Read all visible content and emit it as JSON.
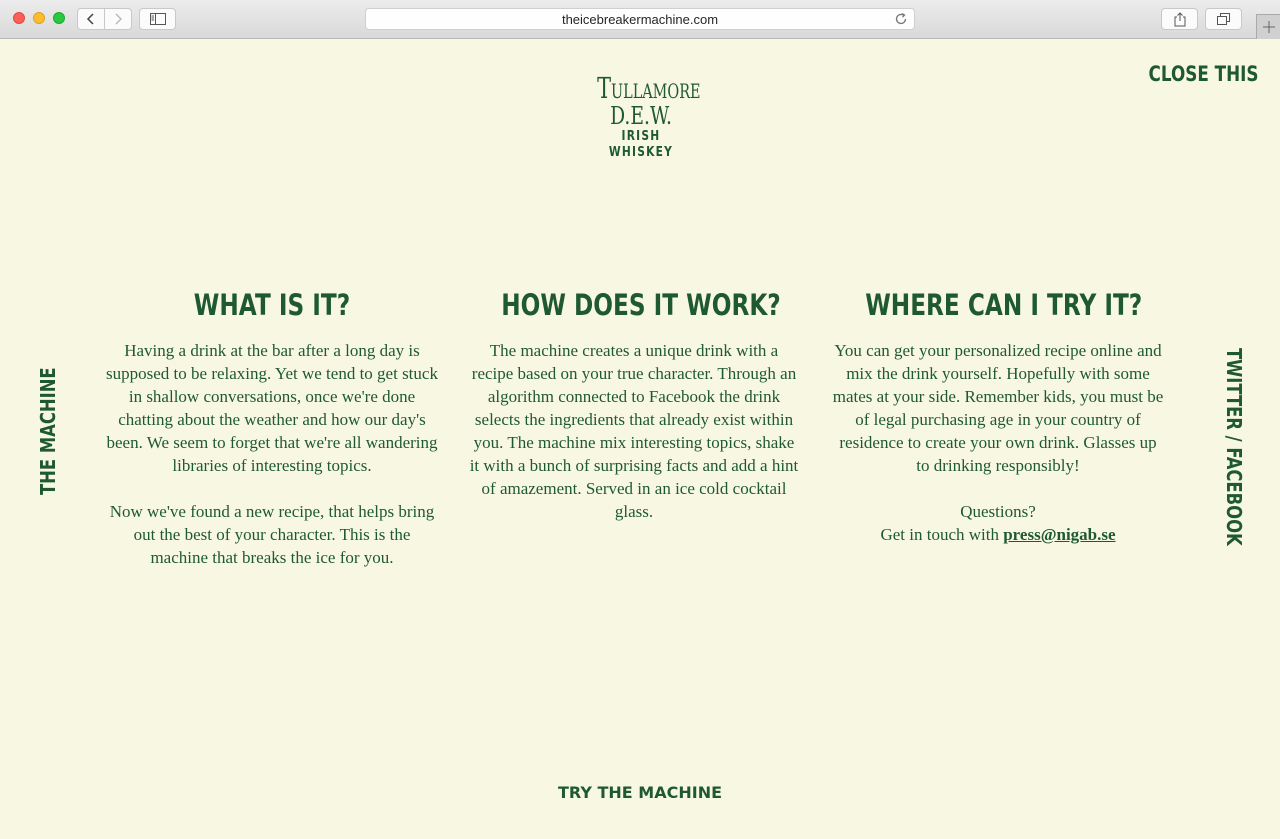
{
  "browser": {
    "url": "theicebreakermachine.com",
    "icons": {
      "back": "chevron-left-icon",
      "forward": "chevron-right-icon",
      "sidebar": "sidebar-icon",
      "reload": "reload-icon",
      "share": "share-icon",
      "tabs": "tabs-icon",
      "new_tab": "plus-icon"
    }
  },
  "logo": {
    "line1": "Tullamore",
    "line2": "D.E.W.",
    "line3": "IRISH WHISKEY"
  },
  "nav": {
    "close": "CLOSE THIS",
    "left": "THE MACHINE",
    "right": "TWITTER / FACEBOOK",
    "bottom": "TRY THE MACHINE"
  },
  "columns": [
    {
      "heading": "WHAT IS IT?",
      "paragraphs": [
        "Having a drink at the bar after a long day is supposed to be relaxing. Yet we tend to get stuck in shallow conversations, once we're done chatting about the weather and how our day's been. We seem to forget that we're all wandering libraries of interesting topics.",
        "Now we've found a new recipe, that helps bring out the best of your character. This is the machine that breaks the ice for you."
      ]
    },
    {
      "heading": "HOW DOES IT WORK?",
      "paragraphs": [
        "The machine creates a unique drink with a recipe based on your true character. Through an algorithm connected to Facebook the drink selects the ingredients that already exist within you. The machine mix interesting topics, shake it with a bunch of surprising facts and add a hint of amazement. Served in an ice cold cocktail glass."
      ]
    },
    {
      "heading": "WHERE CAN I TRY IT?",
      "paragraphs": [
        "You can get your personalized recipe online and mix the drink yourself. Hopefully with some mates at your side. Remember kids, you must be of legal purchasing age in your country of residence to create your own drink. Glasses up to drinking responsibly!"
      ],
      "questions": "Questions?",
      "contact_prefix": "Get in touch with ",
      "email": "press@nigab.se"
    }
  ],
  "colors": {
    "background": "#f8f8e2",
    "brand_green": "#1f5932"
  }
}
